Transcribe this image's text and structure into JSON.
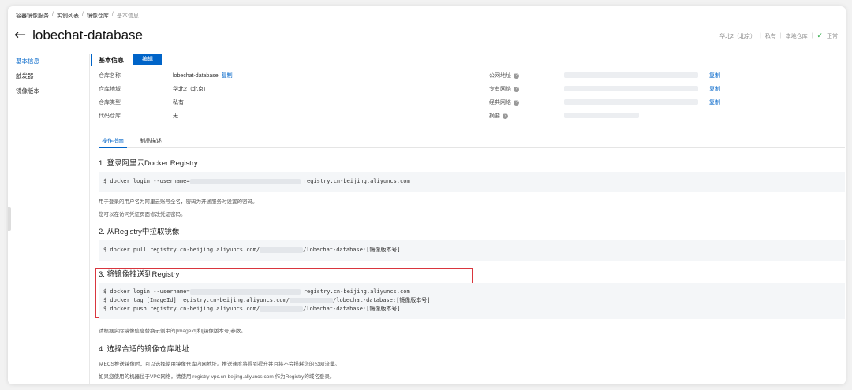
{
  "breadcrumb": [
    "容器镜像服务",
    "实例列表",
    "镜像仓库",
    "基本信息"
  ],
  "page_title": "lobechat-database",
  "status": {
    "region": "华北2（北京）",
    "visibility": "私有",
    "source": "本地仓库",
    "state": "正常"
  },
  "sidebar": {
    "items": [
      {
        "label": "基本信息",
        "active": true
      },
      {
        "label": "触发器",
        "active": false
      },
      {
        "label": "镜像版本",
        "active": false
      }
    ]
  },
  "basic": {
    "title": "基本信息",
    "edit_label": "编辑",
    "copy_label": "复制",
    "left": [
      {
        "key": "仓库名称",
        "value": "lobechat-database",
        "copy": true
      },
      {
        "key": "仓库地域",
        "value": "华北2（北京）",
        "copy": false
      },
      {
        "key": "仓库类型",
        "value": "私有",
        "copy": false
      },
      {
        "key": "代码仓库",
        "value": "无",
        "copy": false
      }
    ],
    "right": [
      {
        "key": "公网地址",
        "copy": true
      },
      {
        "key": "专有网络",
        "copy": true
      },
      {
        "key": "经典网络",
        "copy": true
      },
      {
        "key": "摘要",
        "copy": false
      }
    ]
  },
  "tabs": [
    {
      "label": "操作指南",
      "active": true
    },
    {
      "label": "制品描述",
      "active": false
    }
  ],
  "steps": {
    "s1": {
      "title": "1. 登录阿里云Docker Registry",
      "cmd_prefix": "$ docker login --username=",
      "cmd_suffix": " registry.cn-beijing.aliyuncs.com",
      "note1": "用于登录的用户名为阿里云账号全名，密码为开通服务时设置的密码。",
      "note2": "您可以在访问凭证页面修改凭证密码。"
    },
    "s2": {
      "title": "2. 从Registry中拉取镜像",
      "cmd_prefix": "$ docker pull registry.cn-beijing.aliyuncs.com/",
      "cmd_suffix": "/lobechat-database:[镜像版本号]"
    },
    "s3": {
      "title": "3. 将镜像推送到Registry",
      "line1_prefix": "$ docker login --username=",
      "line1_suffix": " registry.cn-beijing.aliyuncs.com",
      "line2_prefix": "$ docker tag [ImageId] registry.cn-beijing.aliyuncs.com/",
      "line2_suffix": "/lobechat-database:[镜像版本号]",
      "line3_prefix": "$ docker push registry.cn-beijing.aliyuncs.com/",
      "line3_suffix": "/lobechat-database:[镜像版本号]",
      "note": "请根据实际镜像信息替换示例中的[ImageId]和[镜像版本号]参数。"
    },
    "s4": {
      "title": "4. 选择合适的镜像仓库地址",
      "note1": "从ECS推送镜像时，可以选择使用镜像仓库内网地址。推送速度将得到提升并且将不会损耗您的公网流量。",
      "note2": "如果您使用的机器位于VPC网络，请使用 registry-vpc.cn-beijing.aliyuncs.com 作为Registry的域名登录。"
    }
  },
  "colors": {
    "accent": "#0064c8",
    "highlight_box": "#d9363e",
    "ok": "#2eaa46"
  }
}
